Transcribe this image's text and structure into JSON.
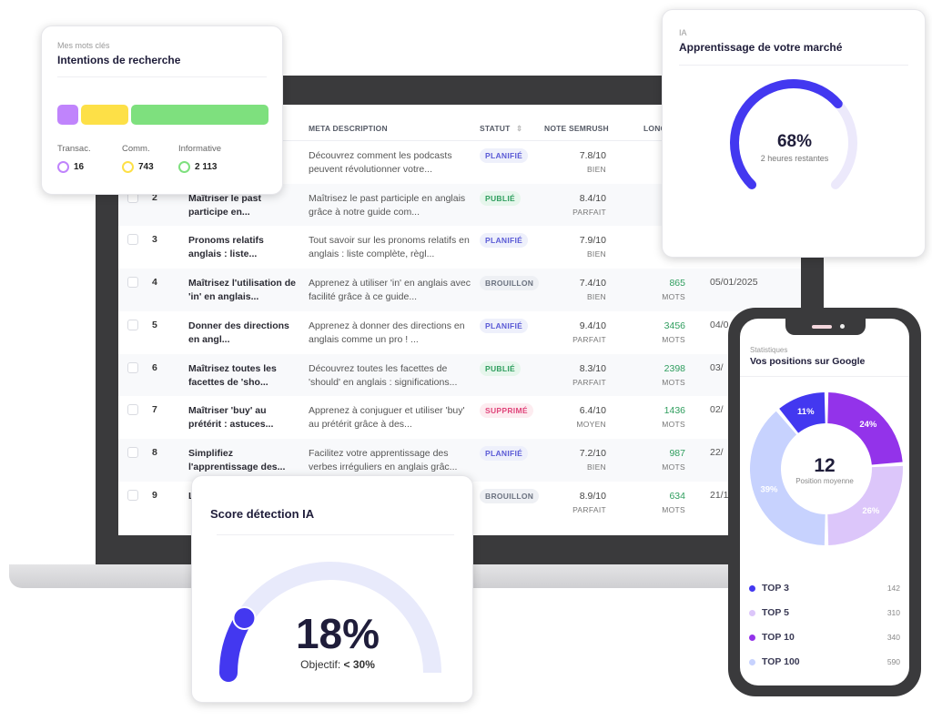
{
  "table": {
    "headers": {
      "meta": "META DESCRIPTION",
      "status": "STATUT",
      "score": "NOTE SEMRUSH",
      "length": "LONG"
    },
    "length_unit": "MOTS",
    "rows": [
      {
        "num": "",
        "title": "",
        "meta": "Découvrez comment les podcasts peuvent révolutionner votre...",
        "status": "PLANIFIÉ",
        "score": "7.8/10",
        "grade": "BIEN",
        "length": "",
        "date": ""
      },
      {
        "num": "2",
        "title": "Maîtriser le past participe en...",
        "meta": "Maîtrisez le past participle en anglais grâce à notre guide com...",
        "status": "PUBLIÉ",
        "score": "8.4/10",
        "grade": "PARFAIT",
        "length": "",
        "date": ""
      },
      {
        "num": "3",
        "title": "Pronoms relatifs anglais : liste...",
        "meta": "Tout savoir sur les pronoms relatifs en anglais : liste complète, règl...",
        "status": "PLANIFIÉ",
        "score": "7.9/10",
        "grade": "BIEN",
        "length": "",
        "date": ""
      },
      {
        "num": "4",
        "title": "Maîtrisez l'utilisation de 'in' en anglais...",
        "meta": "Apprenez à utiliser 'in' en anglais avec facilité grâce à ce guide...",
        "status": "BROUILLON",
        "score": "7.4/10",
        "grade": "BIEN",
        "length": "865",
        "date": "05/01/2025"
      },
      {
        "num": "5",
        "title": "Donner des directions en angl...",
        "meta": "Apprenez à donner des directions en anglais comme un pro ! ...",
        "status": "PLANIFIÉ",
        "score": "9.4/10",
        "grade": "PARFAIT",
        "length": "3456",
        "date": "04/0"
      },
      {
        "num": "6",
        "title": "Maîtrisez toutes les facettes de 'sho...",
        "meta": "Découvrez toutes les facettes de 'should' en anglais : significations...",
        "status": "PUBLIÉ",
        "score": "8.3/10",
        "grade": "PARFAIT",
        "length": "2398",
        "date": "03/"
      },
      {
        "num": "7",
        "title": "Maîtriser 'buy' au prétérit : astuces...",
        "meta": "Apprenez à conjuguer et utiliser 'buy' au prétérit grâce à des...",
        "status": "SUPPRIMÉ",
        "score": "6.4/10",
        "grade": "MOYEN",
        "length": "1436",
        "date": "02/"
      },
      {
        "num": "8",
        "title": "Simplifiez l'apprentissage des...",
        "meta": "Facilitez votre apprentissage des verbes irréguliers en anglais grâc...",
        "status": "PLANIFIÉ",
        "score": "7.2/10",
        "grade": "BIEN",
        "length": "987",
        "date": "22/"
      },
      {
        "num": "9",
        "title": "L a",
        "meta": "",
        "status": "BROUILLON",
        "score": "8.9/10",
        "grade": "PARFAIT",
        "length": "634",
        "date": "21/1"
      }
    ],
    "status_colors": {
      "PLANIFIÉ": {
        "fg": "#5b5bd6",
        "bg": "#eef0fb"
      },
      "PUBLIÉ": {
        "fg": "#2f9e5e",
        "bg": "#e6f6ec"
      },
      "BROUILLON": {
        "fg": "#6b7280",
        "bg": "#eef0f4"
      },
      "SUPPRIMÉ": {
        "fg": "#e0457b",
        "bg": "#fdecf0"
      }
    }
  },
  "intent_card": {
    "kicker": "Mes mots clés",
    "title": "Intentions de recherche",
    "items": [
      {
        "label": "Transac.",
        "value": "16",
        "color": "#c084fc"
      },
      {
        "label": "Comm.",
        "value": "743",
        "color": "#fde047"
      },
      {
        "label": "Informative",
        "value": "2 113",
        "color": "#7ee07e"
      }
    ]
  },
  "market_card": {
    "kicker": "IA",
    "title": "Apprentissage de votre marché",
    "percent_label": "68%",
    "progress": 68,
    "subtitle": "2 heures restantes",
    "color": "#4338f0"
  },
  "score_card": {
    "title": "Score détection IA",
    "percent_label": "18%",
    "progress": 18,
    "objective_label": "Objectif:",
    "objective_value": "< 30%"
  },
  "phone": {
    "kicker": "Statistiques",
    "title": "Vos positions sur Google",
    "center_value": "12",
    "center_label": "Position moyenne",
    "segments": [
      {
        "label": "24%",
        "value": 24,
        "color": "#9333ea"
      },
      {
        "label": "26%",
        "value": 26,
        "color": "#dcc6fa"
      },
      {
        "label": "39%",
        "value": 39,
        "color": "#c7d2fe"
      },
      {
        "label": "11%",
        "value": 11,
        "color": "#4338f0"
      }
    ],
    "legend": [
      {
        "label": "TOP 3",
        "value": "142",
        "color": "#4338f0"
      },
      {
        "label": "TOP 5",
        "value": "310",
        "color": "#dcc6fa"
      },
      {
        "label": "TOP 10",
        "value": "340",
        "color": "#9333ea"
      },
      {
        "label": "TOP 100",
        "value": "590",
        "color": "#c7d2fe"
      }
    ]
  }
}
